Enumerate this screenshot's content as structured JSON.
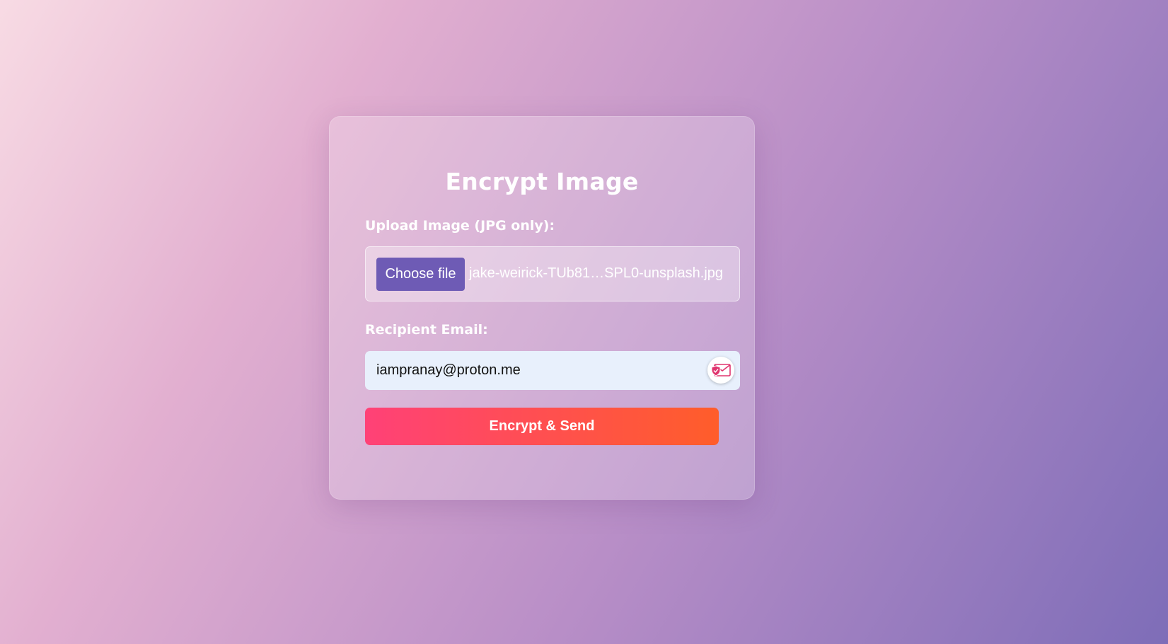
{
  "form": {
    "title": "Encrypt Image",
    "upload_label": "Upload Image (JPG only):",
    "choose_file_label": "Choose file",
    "file_name": "jake-weirick-TUb81…SPL0-unsplash.jpg",
    "email_label": "Recipient Email:",
    "email_value": "iampranay@proton.me",
    "submit_label": "Encrypt & Send"
  },
  "icons": {
    "email_badge": "shield-envelope-icon"
  },
  "colors": {
    "choose_button": "#6e5bb5",
    "submit_gradient_start": "#ff4177",
    "submit_gradient_end": "#ff5d2a",
    "email_input_bg": "#e8f0fc",
    "badge_icon": "#e0356f"
  }
}
